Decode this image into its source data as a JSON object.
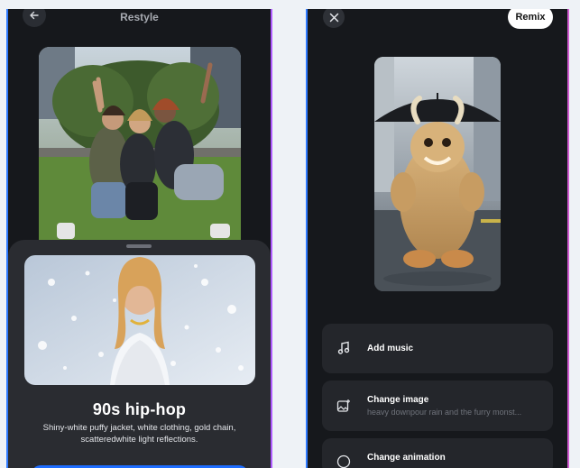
{
  "left_screen": {
    "title": "Restyle",
    "back_icon": "arrow-left-icon",
    "style_sheet": {
      "title": "90s hip-hop",
      "description": "Shiny-white puffy jacket, white clothing, gold chain, scatteredwhite light reflections."
    }
  },
  "right_screen": {
    "close_icon": "close-icon",
    "remix_label": "Remix",
    "options": [
      {
        "icon": "music-note-icon",
        "title": "Add music",
        "subtitle": ""
      },
      {
        "icon": "image-edit-icon",
        "title": "Change image",
        "subtitle": "heavy downpour rain and the furry monst..."
      },
      {
        "icon": "animation-icon",
        "title": "Change animation",
        "subtitle": ""
      }
    ]
  },
  "colors": {
    "accent_blue": "#1e6dff",
    "panel_dark": "#16181c",
    "sheet_dark": "#2a2c31",
    "card_dark": "#24262b"
  }
}
